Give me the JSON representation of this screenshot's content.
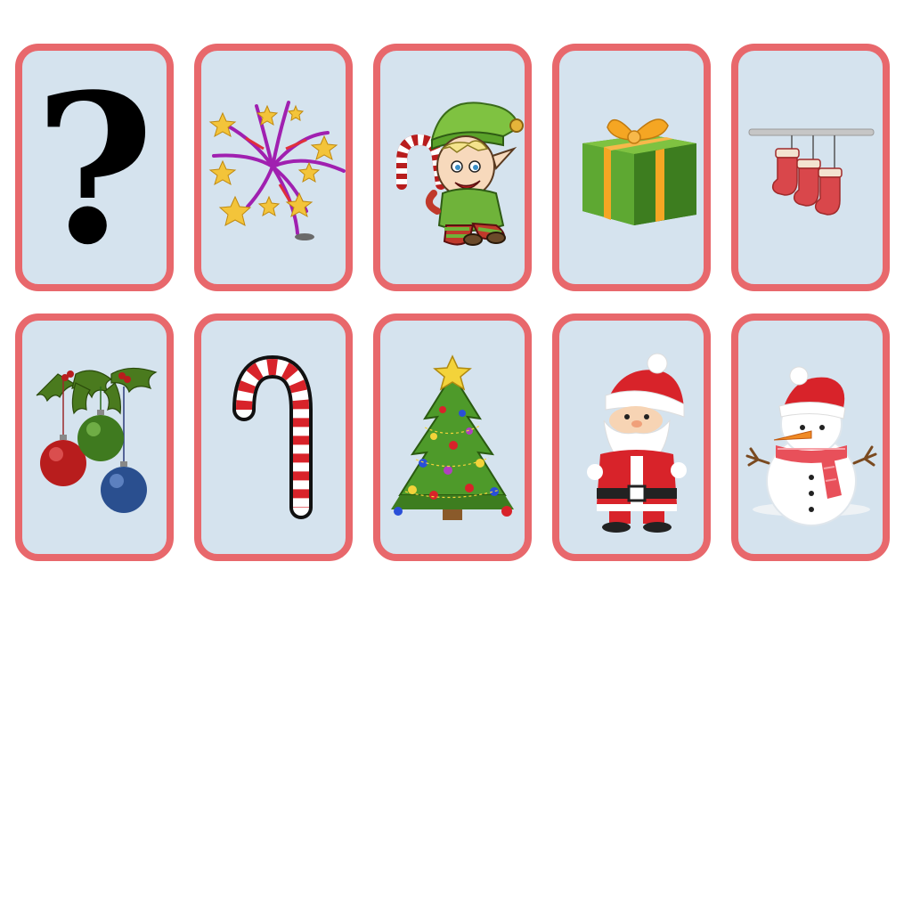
{
  "board": {
    "card_border_color": "#e8686c",
    "card_face_color": "#d5e3ee",
    "rows": 2,
    "columns": 5
  },
  "cards": [
    {
      "state": "face-down",
      "symbol": "?",
      "icon": "question-mark-icon"
    },
    {
      "state": "face-up",
      "icon": "fireworks-icon"
    },
    {
      "state": "face-up",
      "icon": "elf-icon"
    },
    {
      "state": "face-up",
      "icon": "gift-box-icon"
    },
    {
      "state": "face-up",
      "icon": "stockings-icon"
    },
    {
      "state": "face-up",
      "icon": "ornaments-holly-icon"
    },
    {
      "state": "face-up",
      "icon": "candy-cane-icon"
    },
    {
      "state": "face-up",
      "icon": "christmas-tree-icon"
    },
    {
      "state": "face-up",
      "icon": "santa-icon"
    },
    {
      "state": "face-up",
      "icon": "snowman-icon"
    }
  ]
}
